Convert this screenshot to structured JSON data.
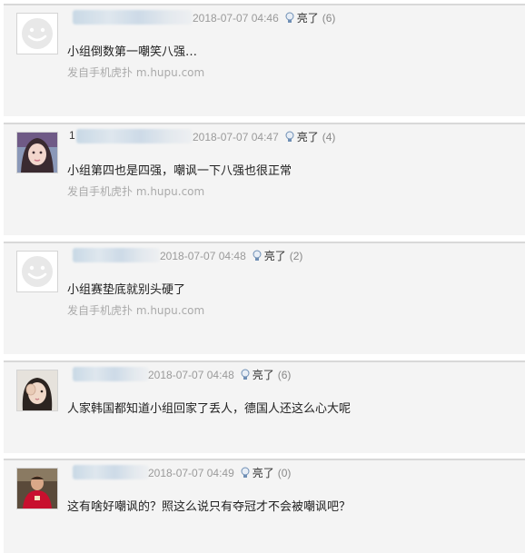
{
  "comments": [
    {
      "username_visible": "",
      "time": "2018-07-07 04:46",
      "like_label": "亮了",
      "like_count": "(6)",
      "content": "小组倒数第一嘲笑八强…",
      "source": "发自手机虎扑 m.hupu.com"
    },
    {
      "username_visible": "1",
      "time": "2018-07-07 04:47",
      "like_label": "亮了",
      "like_count": "(4)",
      "content": "小组第四也是四强，嘲讽一下八强也很正常",
      "source": "发自手机虎扑 m.hupu.com"
    },
    {
      "username_visible": "",
      "time": "2018-07-07 04:48",
      "like_label": "亮了",
      "like_count": "(2)",
      "content": "小组赛垫底就别头硬了",
      "source": "发自手机虎扑 m.hupu.com"
    },
    {
      "username_visible": "",
      "time": "2018-07-07 04:48",
      "like_label": "亮了",
      "like_count": "(6)",
      "content": "人家韩国都知道小组回家了丢人，德国人还这么心大呢",
      "source": ""
    },
    {
      "username_visible": "",
      "time": "2018-07-07 04:49",
      "like_label": "亮了",
      "like_count": "(0)",
      "content": "这有啥好嘲讽的？照这么说只有夺冠才不会被嘲讽吧？",
      "source": ""
    }
  ],
  "avatars": [
    "default-avatar-icon",
    "girl-photo-avatar",
    "default-avatar-icon",
    "girl-hand-photo-avatar",
    "football-player-photo-avatar"
  ],
  "colors": {
    "card_bg": "#f4f4f4",
    "divider": "#d8d8d8",
    "meta_text": "#999999",
    "source_text": "#aaaaaa",
    "content_text": "#222222"
  }
}
